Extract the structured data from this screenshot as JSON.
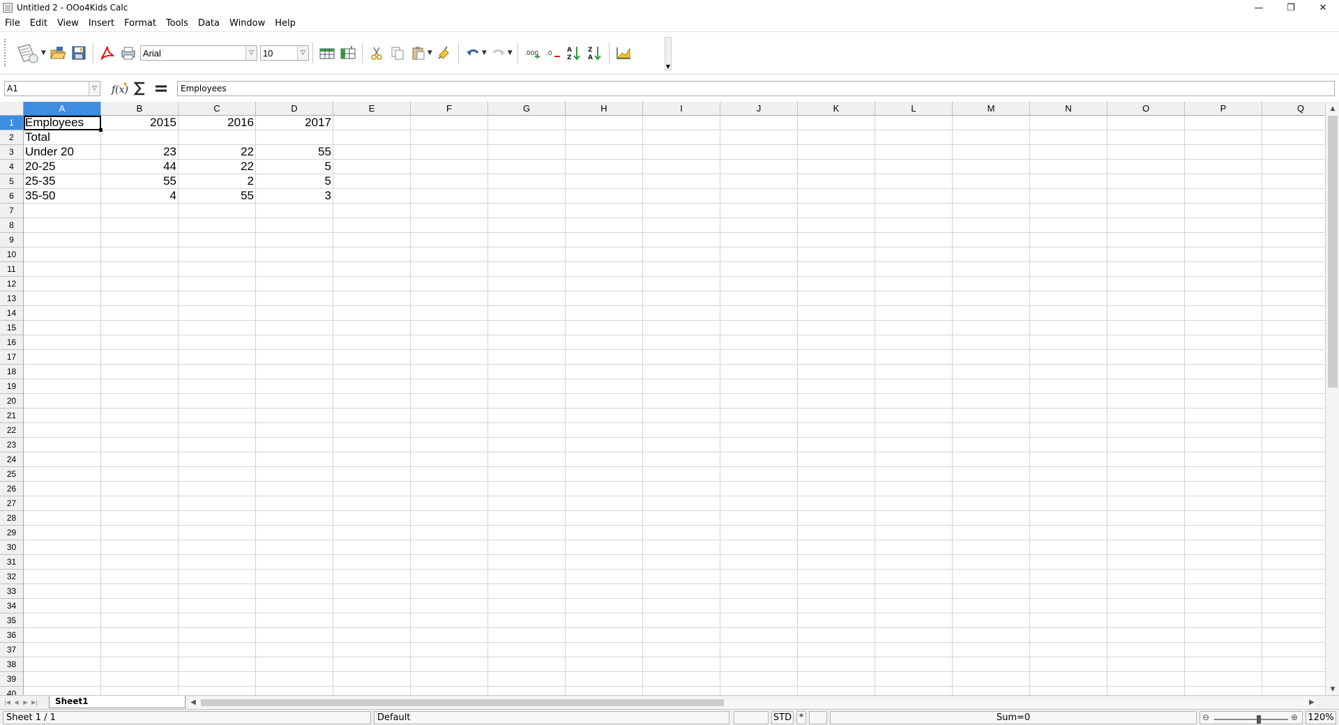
{
  "window": {
    "title": "Untitled 2 - OOo4Kids Calc",
    "controls": [
      "—",
      "❐",
      "✕"
    ]
  },
  "menu": [
    "File",
    "Edit",
    "View",
    "Insert",
    "Format",
    "Tools",
    "Data",
    "Window",
    "Help"
  ],
  "toolbar": {
    "font_name": "Arial",
    "font_size": "10",
    "icons": [
      "new-document-icon",
      "open-folder-icon",
      "save-icon",
      "export-pdf-icon",
      "print-icon",
      "insert-rows-icon",
      "insert-columns-icon",
      "cut-icon",
      "copy-icon",
      "paste-icon",
      "clone-formatting-icon",
      "undo-icon",
      "redo-icon",
      "add-decimal-icon",
      "delete-decimal-icon",
      "sort-ascending-icon",
      "sort-descending-icon",
      "chart-icon"
    ]
  },
  "formula_bar": {
    "name_box": "A1",
    "content": "Employees",
    "icons": [
      "function-wizard-icon",
      "sum-icon",
      "equals-icon"
    ]
  },
  "sheet": {
    "columns": [
      "A",
      "B",
      "C",
      "D",
      "E",
      "F",
      "G",
      "H",
      "I",
      "J",
      "K",
      "L",
      "M",
      "N",
      "O",
      "P",
      "Q"
    ],
    "selected_column": "A",
    "selected_row": 1,
    "row_count": 40,
    "rows": [
      [
        "Employees",
        "2015",
        "2016",
        "2017"
      ],
      [
        "Total",
        "",
        "",
        ""
      ],
      [
        "Under 20",
        "23",
        "22",
        "55"
      ],
      [
        "20-25",
        "44",
        "22",
        "5"
      ],
      [
        "25-35",
        "55",
        "2",
        "5"
      ],
      [
        "35-50",
        "4",
        "55",
        "3"
      ]
    ]
  },
  "tabs": {
    "active": "Sheet1"
  },
  "status": {
    "sheet": "Sheet 1 / 1",
    "page_style": "Default",
    "mode": "STD",
    "modifier": "*",
    "sum": "Sum=0",
    "zoom": "120%",
    "zoom_fraction": 0.6
  }
}
